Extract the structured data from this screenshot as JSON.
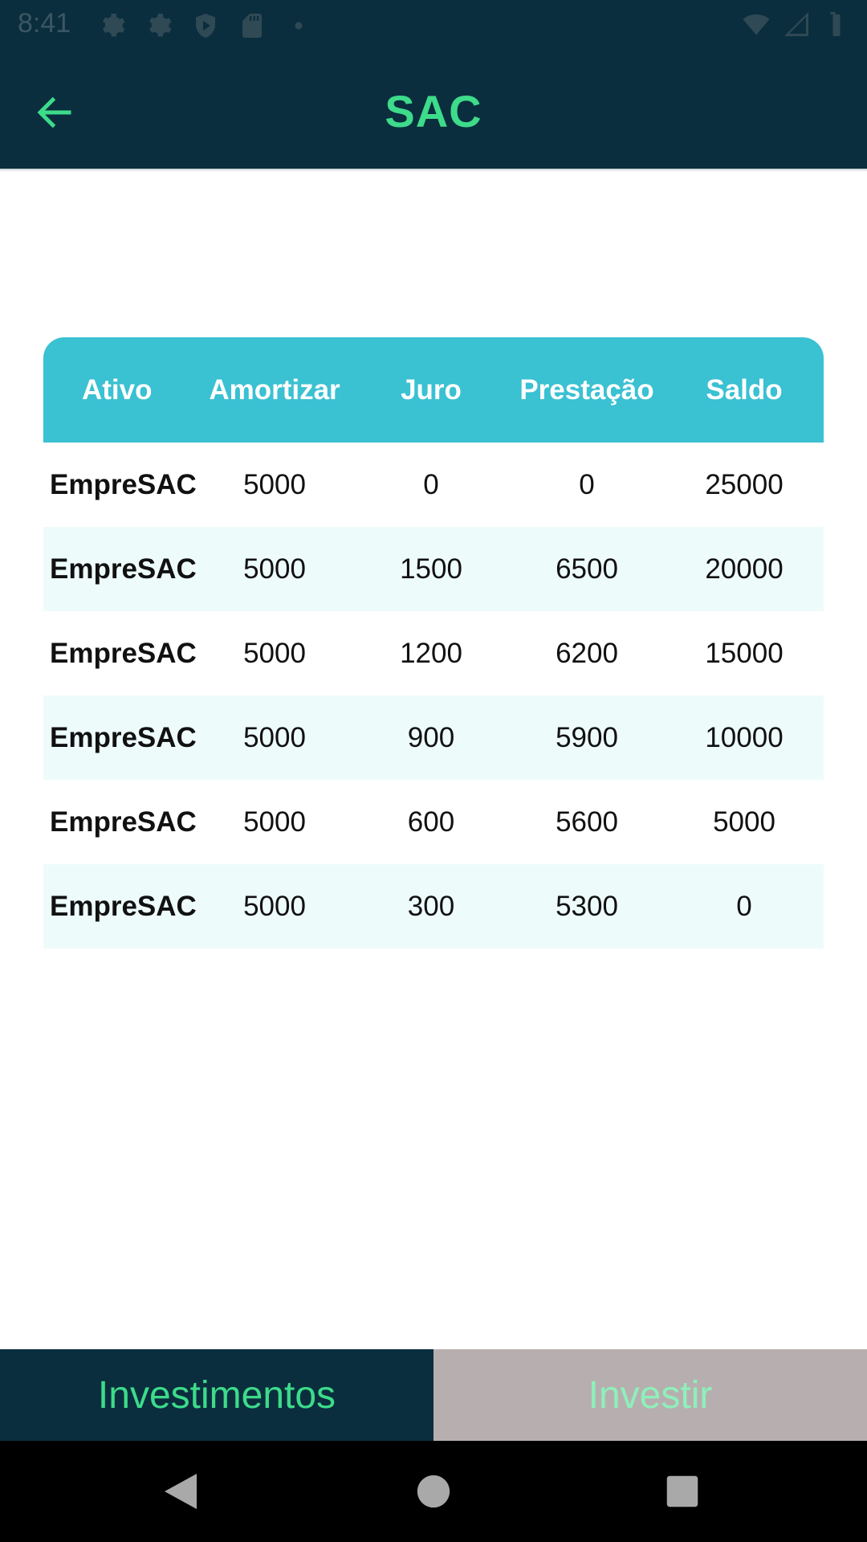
{
  "status_bar": {
    "time": "8:41",
    "icons_left": [
      "gear-icon",
      "gear-icon",
      "shield-icon",
      "sd-card-icon",
      "dot-icon"
    ],
    "icons_right": [
      "wifi-off-icon",
      "signal-icon",
      "battery-icon"
    ]
  },
  "app_bar": {
    "title": "SAC",
    "back_icon": "arrow-left-icon",
    "title_color": "#3ddb8a",
    "background": "#0a2e3e"
  },
  "table": {
    "header_color": "#3ac1d2",
    "columns": [
      "Ativo",
      "Amortizar",
      "Juro",
      "Prestação",
      "Saldo"
    ],
    "rows": [
      [
        "EmpreSAC",
        "5000",
        "0",
        "0",
        "25000"
      ],
      [
        "EmpreSAC",
        "5000",
        "1500",
        "6500",
        "20000"
      ],
      [
        "EmpreSAC",
        "5000",
        "1200",
        "6200",
        "15000"
      ],
      [
        "EmpreSAC",
        "5000",
        "900",
        "5900",
        "10000"
      ],
      [
        "EmpreSAC",
        "5000",
        "600",
        "5600",
        "5000"
      ],
      [
        "EmpreSAC",
        "5000",
        "300",
        "5300",
        "0"
      ]
    ]
  },
  "bottom_tabs": {
    "investimentos": "Investimentos",
    "investir": "Investir"
  },
  "nav_bar": {
    "back": "back-triangle-icon",
    "home": "home-circle-icon",
    "recents": "recents-square-icon"
  }
}
